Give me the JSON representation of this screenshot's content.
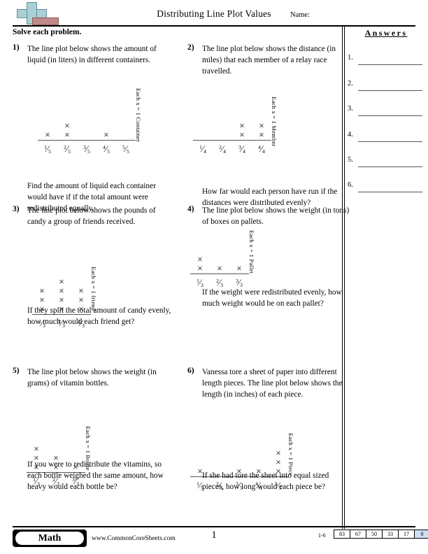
{
  "header": {
    "title": "Distributing Line Plot Values",
    "name_label": "Name:",
    "logo": "plus-block-logo"
  },
  "instruction": "Solve each problem.",
  "answers": {
    "heading": "Answers",
    "rows": [
      {
        "number": "1."
      },
      {
        "number": "2."
      },
      {
        "number": "3."
      },
      {
        "number": "4."
      },
      {
        "number": "5."
      },
      {
        "number": "6."
      }
    ]
  },
  "problems": [
    {
      "number": "1)",
      "text": "The line plot below shows the amount of liquid (in liters) in different containers.",
      "question": "Find the amount of liquid each container would have if if the total amount were redistributed equally.",
      "plot": {
        "legend": "Each x = 1 Container",
        "ticks": [
          {
            "num": "1",
            "den": "5",
            "count": 1
          },
          {
            "num": "2",
            "den": "5",
            "count": 2
          },
          {
            "num": "3",
            "den": "5",
            "count": 0
          },
          {
            "num": "4",
            "den": "5",
            "count": 1
          },
          {
            "num": "5",
            "den": "5",
            "count": 0
          }
        ]
      }
    },
    {
      "number": "2)",
      "text": "The line plot below shows the distance (in miles) that each member of a relay race travelled.",
      "question": "How far would each person have run if the distances were distributed evenly?",
      "plot": {
        "legend": "Each x = 1 Member",
        "ticks": [
          {
            "num": "1",
            "den": "4",
            "count": 0
          },
          {
            "num": "2",
            "den": "4",
            "count": 0
          },
          {
            "num": "3",
            "den": "4",
            "count": 2
          },
          {
            "num": "4",
            "den": "4",
            "count": 2
          }
        ]
      }
    },
    {
      "number": "3)",
      "text": "The line plot below shows the pounds of candy a group of friends received.",
      "question": "If they split the total amount of candy evenly, how much would each friend get?",
      "plot": {
        "legend": "Each x = 1 friend",
        "ticks": [
          {
            "num": "1",
            "den": "3",
            "count": 3
          },
          {
            "num": "2",
            "den": "3",
            "count": 4
          },
          {
            "num": "3",
            "den": "3",
            "count": 3
          }
        ]
      }
    },
    {
      "number": "4)",
      "text": "The line plot below shows the weight (in tons) of boxes on pallets.",
      "question": "If the weight were redistributed evenly, how much weight would be on each pallet?",
      "plot": {
        "legend": "Each x = 1 Pallet",
        "ticks": [
          {
            "num": "1",
            "den": "3",
            "count": 2
          },
          {
            "num": "2",
            "den": "3",
            "count": 1
          },
          {
            "num": "3",
            "den": "3",
            "count": 1
          }
        ]
      }
    },
    {
      "number": "5)",
      "text": "The line plot below shows the weight (in grams) of vitamin bottles.",
      "question": "If you were to redistribute the vitamins, so each bottle weighed the same amount, how heavy would each bottle be?",
      "plot": {
        "legend": "Each x = 1 Bottle",
        "ticks": [
          {
            "num": "1",
            "den": "3",
            "count": 3
          },
          {
            "num": "2",
            "den": "3",
            "count": 2
          },
          {
            "num": "3",
            "den": "3",
            "count": 1
          }
        ]
      }
    },
    {
      "number": "6)",
      "text": "Vanessa tore a sheet of paper into different length pieces. The line plot below shows the length (in inches) of each piece.",
      "question": "If she had tore the sheet into equal sized pieces, how long would each piece be?",
      "plot": {
        "legend": "Each x = 1 Piece",
        "ticks": [
          {
            "num": "1",
            "den": "5",
            "count": 1
          },
          {
            "num": "2",
            "den": "5",
            "count": 0
          },
          {
            "num": "3",
            "den": "5",
            "count": 1
          },
          {
            "num": "4",
            "den": "5",
            "count": 1
          },
          {
            "num": "5",
            "den": "5",
            "count": 3
          }
        ]
      }
    }
  ],
  "footer": {
    "badge": "Math",
    "url": "www.CommonCoreSheets.com",
    "page": "1",
    "score_range": "1-6",
    "scores": [
      "83",
      "67",
      "50",
      "33",
      "17",
      "0"
    ],
    "highlight_color": "#cfe0f5"
  }
}
